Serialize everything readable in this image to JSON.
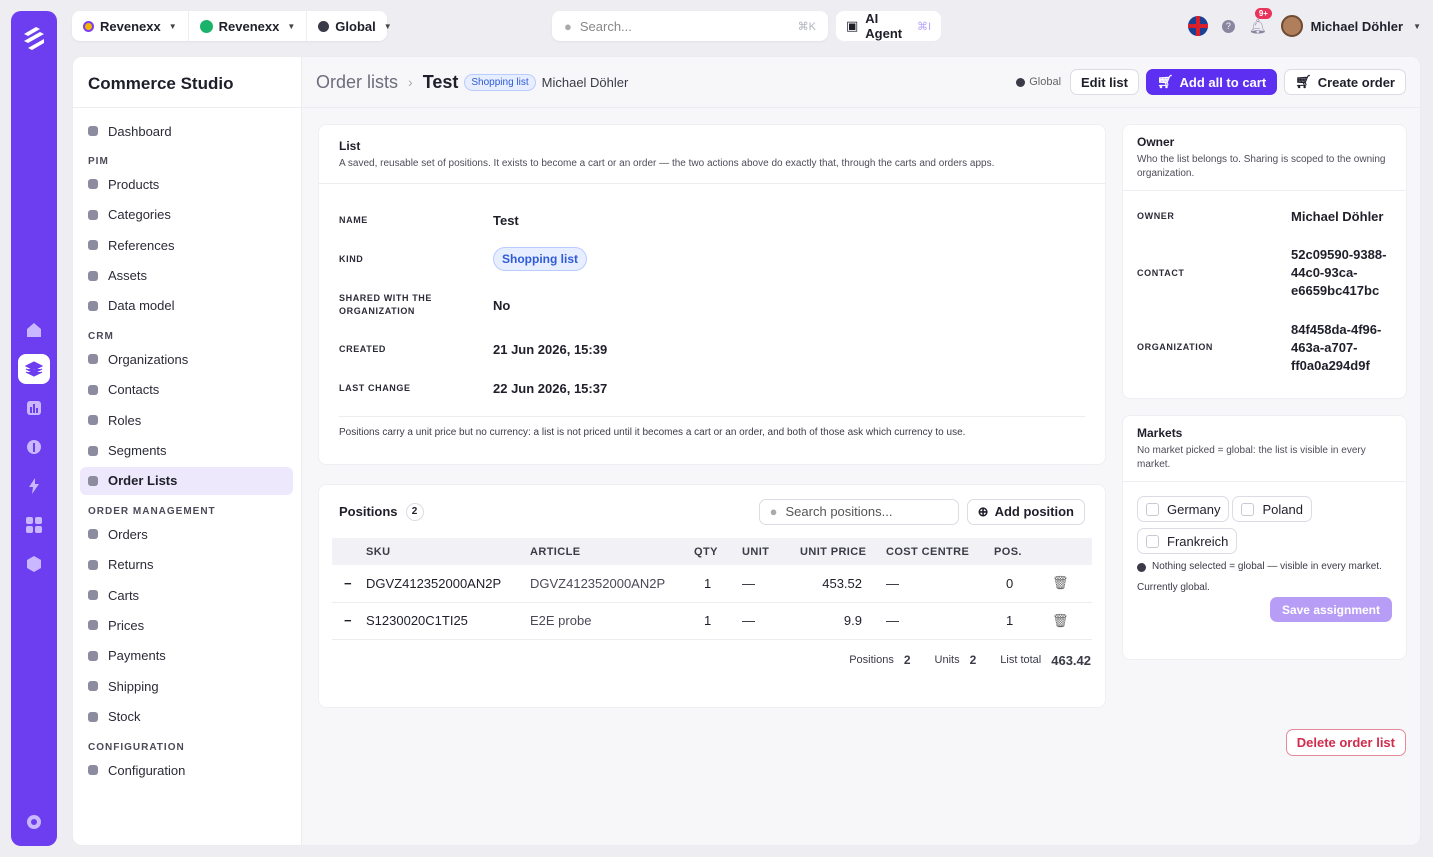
{
  "scope": {
    "tenant": "Revenexx",
    "org": "Revenexx",
    "market": "Global"
  },
  "search": {
    "placeholder": "Search...",
    "shortcut": "⌘K"
  },
  "ai_agent": {
    "label": "AI Agent",
    "shortcut": "⌘I"
  },
  "notifications": {
    "badge": "9+"
  },
  "user": {
    "name": "Michael Döhler"
  },
  "studio": {
    "title": "Commerce Studio"
  },
  "nav": {
    "dashboard": "Dashboard",
    "pim_section": "PIM",
    "products": "Products",
    "categories": "Categories",
    "references": "References",
    "assets": "Assets",
    "data_model": "Data model",
    "crm_section": "CRM",
    "organizations": "Organizations",
    "contacts": "Contacts",
    "roles": "Roles",
    "segments": "Segments",
    "order_lists": "Order Lists",
    "order_mgmt_section": "ORDER MANAGEMENT",
    "orders": "Orders",
    "returns": "Returns",
    "carts": "Carts",
    "prices": "Prices",
    "payments": "Payments",
    "shipping": "Shipping",
    "stock": "Stock",
    "config_section": "CONFIGURATION",
    "configuration": "Configuration"
  },
  "header": {
    "crumb_root": "Order lists",
    "title": "Test",
    "kind_chip": "Shopping list",
    "owner": "Michael Döhler",
    "global_label": "Global",
    "edit_list": "Edit list",
    "add_all_to_cart": "Add all to cart",
    "create_order": "Create order"
  },
  "list_card": {
    "title": "List",
    "subtitle": "A saved, reusable set of positions. It exists to become a cart or an order — the two actions above do exactly that, through the carts and orders apps.",
    "name_label": "NAME",
    "name_value": "Test",
    "kind_label": "KIND",
    "kind_value": "Shopping list",
    "shared_label_1": "SHARED WITH THE",
    "shared_label_2": "ORGANIZATION",
    "shared_value": "No",
    "created_label": "CREATED",
    "created_value": "21 Jun 2026, 15:39",
    "last_change_label": "LAST CHANGE",
    "last_change_value": "22 Jun 2026, 15:37",
    "note": "Positions carry a unit price but no currency: a list is not priced until it becomes a cart or an order, and both of those ask which currency to use."
  },
  "positions": {
    "title": "Positions",
    "count": "2",
    "search_placeholder": "Search positions...",
    "add_label": "Add position",
    "columns": [
      "SKU",
      "ARTICLE",
      "QTY",
      "UNIT",
      "UNIT PRICE",
      "COST CENTRE",
      "POS."
    ],
    "rows": [
      {
        "sku": "DGVZ412352000AN2P",
        "article": "DGVZ412352000AN2P",
        "qty": "1",
        "unit": "—",
        "unit_price": "453.52",
        "cost_centre": "—",
        "pos": "0"
      },
      {
        "sku": "S1230020C1TI25",
        "article": "E2E probe",
        "qty": "1",
        "unit": "—",
        "unit_price": "9.9",
        "cost_centre": "—",
        "pos": "1"
      }
    ],
    "totals": {
      "positions_label": "Positions",
      "positions_value": "2",
      "units_label": "Units",
      "units_value": "2",
      "total_label": "List total",
      "total_value": "463.42"
    }
  },
  "owner_card": {
    "title": "Owner",
    "subtitle": "Who the list belongs to. Sharing is scoped to the owning organization.",
    "owner_label": "OWNER",
    "owner_value": "Michael Döhler",
    "contact_label": "CONTACT",
    "contact_lines": [
      "52c09590-9388-",
      "44c0-93ca-",
      "e6659bc417bc"
    ],
    "org_label": "ORGANIZATION",
    "org_lines": [
      "84f458da-4f96-",
      "463a-a707-",
      "ff0a0a294d9f"
    ]
  },
  "markets_card": {
    "title": "Markets",
    "subtitle": "No market picked = global: the list is visible in every market.",
    "options": [
      "Germany",
      "Poland",
      "Frankreich"
    ],
    "hint": "Nothing selected = global — visible in every market.",
    "current": "Currently global.",
    "save_label": "Save assignment"
  },
  "delete_label": "Delete order list",
  "colors": {
    "brand": "#6d3df0",
    "primary_button": "#5d2ff0",
    "chip_blue": "#2f5bd6",
    "danger": "#d22b4e"
  }
}
